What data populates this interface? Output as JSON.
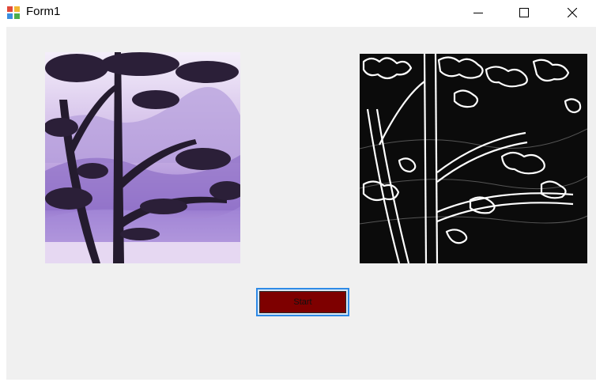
{
  "window": {
    "title": "Form1",
    "controls": {
      "minimize": "minimize",
      "maximize": "maximize",
      "close": "close"
    }
  },
  "images": [
    {
      "name": "original-image",
      "description_icon": "tree-painting"
    },
    {
      "name": "edge-image",
      "description_icon": "tree-edge-detection"
    }
  ],
  "start_button": {
    "label": "Start",
    "color": "#7e0000"
  },
  "colors": {
    "form_background": "#f0f0f0",
    "button_focus_border": "#2e8ae6"
  }
}
